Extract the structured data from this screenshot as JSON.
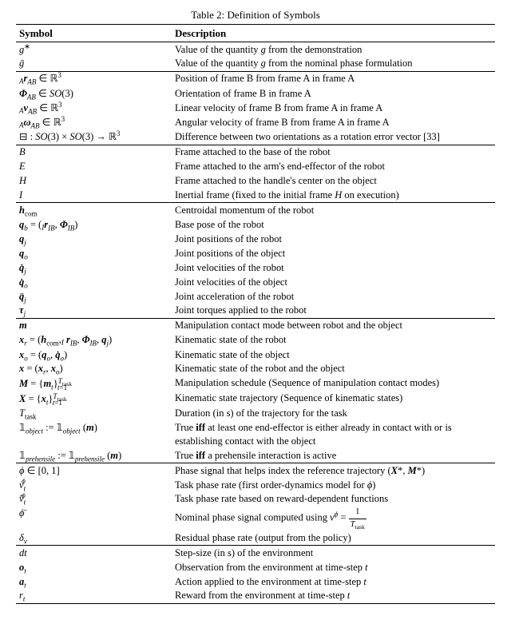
{
  "caption": "Table 2: Definition of Symbols",
  "headers": {
    "symbol": "Symbol",
    "description": "Description"
  },
  "groups": [
    {
      "rows": [
        {
          "sym_html": "<span class='math'>g</span><sup>∗</sup>",
          "desc": "Value of the quantity g from the demonstration"
        },
        {
          "sym_html": "<span class='math'>ḡ</span>",
          "desc": "Value of the quantity g from the nominal phase formulation"
        }
      ]
    },
    {
      "rows": [
        {
          "sym_html": "<span class='presub'>A</span><span class='math bold'>r</span><sub><span class='math'>AB</span></sub> <span class='op'>∈</span> <span class='bb'>ℝ</span><sup>3</sup>",
          "desc": "Position of frame B from frame A in frame A"
        },
        {
          "sym_html": "<span class='math bold'>Φ</span><sub><span class='math'>AB</span></sub> <span class='op'>∈</span> <span class='math'>SO</span>(3)",
          "desc": "Orientation of frame B in frame A"
        },
        {
          "sym_html": "<span class='presub'>A</span><span class='math bold'>v</span><sub><span class='math'>AB</span></sub> <span class='op'>∈</span> <span class='bb'>ℝ</span><sup>3</sup>",
          "desc": "Linear velocity of frame B from frame A in frame A"
        },
        {
          "sym_html": "<span class='presub'>A</span><span class='math bold'>ω</span><sub><span class='math'>AB</span></sub> <span class='op'>∈</span> <span class='bb'>ℝ</span><sup>3</sup>",
          "desc": "Angular velocity of frame B from frame A in frame A"
        },
        {
          "sym_html": "<span class='op'>⊟</span> : <span class='math'>SO</span>(3) × <span class='math'>SO</span>(3) → <span class='bb'>ℝ</span><sup>3</sup>",
          "desc": "Difference between two orientations as a rotation error vector [33]"
        }
      ]
    },
    {
      "rows": [
        {
          "sym_html": "<span class='math'>B</span>",
          "desc": "Frame attached to the base of the robot"
        },
        {
          "sym_html": "<span class='math'>E</span>",
          "desc": "Frame attached to the arm's end-effector of the robot"
        },
        {
          "sym_html": "<span class='math'>H</span>",
          "desc": "Frame attached to the handle's center on the object"
        },
        {
          "sym_html": "<span class='math'>I</span>",
          "desc": "Inertial frame (fixed to the initial frame H on execution)"
        }
      ]
    },
    {
      "rows": [
        {
          "sym_html": "<span class='math bold'>h</span><sub><span class='rm'>com</span></sub>",
          "desc": "Centroidal momentum of the robot"
        },
        {
          "sym_html": "<span class='math bold'>q</span><sub><span class='math'>b</span></sub> = (<span class='presub'>I</span><span class='math bold'>r</span><sub><span class='math'>IB</span></sub>, <span class='math bold'>Φ</span><sub><span class='math'>IB</span></sub>)",
          "desc": "Base pose of the robot"
        },
        {
          "sym_html": "<span class='math bold'>q</span><sub><span class='math'>j</span></sub>",
          "desc": "Joint positions of the robot"
        },
        {
          "sym_html": "<span class='math bold'>q</span><sub><span class='math'>o</span></sub>",
          "desc": "Joint positions of the object"
        },
        {
          "sym_html": "<span class='math bold'>q̇</span><sub><span class='math'>j</span></sub>",
          "desc": "Joint velocities of the robot"
        },
        {
          "sym_html": "<span class='math bold'>q̇</span><sub><span class='math'>o</span></sub>",
          "desc": "Joint velocities of the object"
        },
        {
          "sym_html": "<span class='math bold'>q̈</span><sub><span class='math'>j</span></sub>",
          "desc": "Joint acceleration of the robot"
        },
        {
          "sym_html": "<span class='math bold'>τ</span><sub><span class='math'>j</span></sub>",
          "desc": "Joint torques applied to the robot"
        }
      ]
    },
    {
      "rows": [
        {
          "sym_html": "<span class='math bold'>m</span>",
          "desc": "Manipulation contact mode between robot and the object"
        },
        {
          "sym_html": "<span class='math bold'>x</span><sub><span class='math'>r</span></sub> = (<span class='math bold'>h</span><sub><span class='rm'>com</span></sub>,<span class='presub'>I</span> <span class='math bold'>r</span><sub><span class='math'>IB</span></sub>, <span class='math bold'>Φ</span><sub><span class='math'>IB</span></sub>, <span class='math bold'>q</span><sub><span class='math'>j</span></sub>)",
          "desc": "Kinematic state of the robot"
        },
        {
          "sym_html": "<span class='math bold'>x</span><sub><span class='math'>o</span></sub> = (<span class='math bold'>q</span><sub><span class='math'>o</span></sub>, <span class='math bold'>q̇</span><sub><span class='math'>o</span></sub>)",
          "desc": "Kinematic state of the object"
        },
        {
          "sym_html": "<span class='math bold'>x</span> = (<span class='math bold'>x</span><sub><span class='math'>r</span></sub>, <span class='math bold'>x</span><sub><span class='math'>o</span></sub>)",
          "desc": "Kinematic state of the robot and the object"
        },
        {
          "sym_html": "<span class='math bold'>M</span> = {<span class='math bold'>m</span><sub><span class='math'>t</span></sub>}<span class='presup'>T<sub class='rm' style='font-size:0.85em'>task</sub></span><sub style='margin-left:-18px'><span class='math'>t</span>=1</sub>",
          "desc": "Manipulation schedule (Sequence of manipulation contact modes)"
        },
        {
          "sym_html": "<span class='math bold'>X</span> = {<span class='math bold'>x</span><sub><span class='math'>t</span></sub>}<span class='presup'>T<sub class='rm' style='font-size:0.85em'>task</sub></span><sub style='margin-left:-18px'><span class='math'>t</span>=1</sub>",
          "desc": "Kinematic state trajectory (Sequence of kinematic states)"
        },
        {
          "sym_html": "<span class='math'>T</span><sub><span class='rm'>task</span></sub>",
          "desc": "Duration (in s) of the trajectory for the task"
        },
        {
          "sym_html": "<span class='dsone'>𝟙</span><sub><span class='math'>object</span></sub> := <span class='dsone'>𝟙</span><sub><span class='math'>object</span></sub> (<span class='math bold'>m</span>)",
          "desc": "True iff at least one end-effector is either already in contact with or is establishing contact with the object"
        },
        {
          "sym_html": "<span class='dsone'>𝟙</span><sub><span class='math'>prehensile</span></sub> := <span class='dsone'>𝟙</span><sub><span class='math'>prehensile</span></sub> (<span class='math bold'>m</span>)",
          "desc": "True iff a prehensile interaction is active"
        }
      ]
    },
    {
      "rows": [
        {
          "sym_html": "<span class='math'>ϕ</span> <span class='op'>∈</span> [0, 1]",
          "desc": "Phase signal that helps index the reference trajectory (X*, M*)"
        },
        {
          "sym_html": "<span class='math'>v</span><sub><span class='math'>t</span></sub><sup style='margin-left:-5px'><span class='math'>ϕ</span></sup>",
          "desc": "Task phase rate (first order-dynamics model for ϕ)"
        },
        {
          "sym_html": "<span class='math'>v̂</span><sub><span class='math'>t</span></sub><sup style='margin-left:-5px'><span class='math'>ϕ</span></sup>",
          "desc": "Task phase rate based on reward-dependent functions"
        },
        {
          "sym_html": "<span class='math'>ϕ̄</span>",
          "desc_html": "Nominal phase signal computed using <span class='math'>v</span><sup><span class='math'>ϕ</span></sup> = <span style='display:inline-block;text-align:center;vertical-align:middle;font-size:0.85em'><span style='display:block;border-bottom:0.5px solid #000;padding:0 2px'>1</span><span style='display:block;padding:0 2px'><span class='math'>T</span><sub class='rm'>task</sub></span></span>"
        },
        {
          "sym_html": "<span class='math'>δ</span><sub><span class='math'>v</span></sub>",
          "desc": "Residual phase rate (output from the policy)"
        }
      ]
    },
    {
      "rows": [
        {
          "sym_html": "<span class='math'>dt</span>",
          "desc": "Step-size (in s) of the environment"
        },
        {
          "sym_html": "<span class='math bold'>o</span><sub><span class='math'>t</span></sub>",
          "desc": "Observation from the environment at time-step t"
        },
        {
          "sym_html": "<span class='math bold'>a</span><sub><span class='math'>t</span></sub>",
          "desc": "Action applied to the environment at time-step t"
        },
        {
          "sym_html": "<span class='math'>r</span><sub><span class='math'>t</span></sub>",
          "desc": "Reward from the environment at time-step t"
        }
      ]
    }
  ]
}
